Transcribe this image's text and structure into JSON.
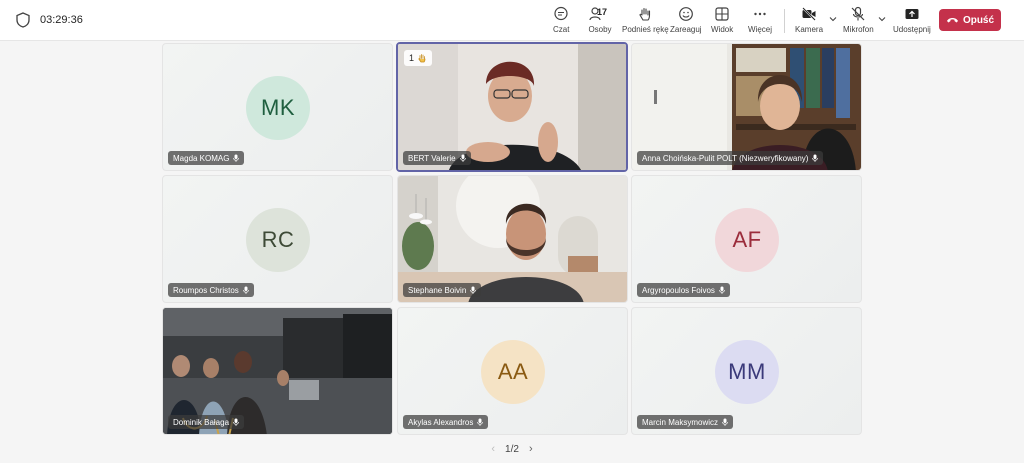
{
  "topbar": {
    "timer": "03:29:36",
    "buttons": {
      "chat": "Czat",
      "people": "Osoby",
      "people_count": "17",
      "raise": "Podnieś rękę",
      "react": "Zareaguj",
      "view": "Widok",
      "more": "Więcej",
      "camera": "Kamera",
      "mic": "Mikrofon",
      "share": "Udostępnij",
      "leave": "Opuść"
    }
  },
  "tiles": [
    {
      "name": "Magda KOMAG",
      "initials": "MK",
      "avatar_bg": "#cfe8dc",
      "avatar_fg": "#1f5f3f"
    },
    {
      "name": "BERT Valerie",
      "hand_count": "1"
    },
    {
      "name": "Anna Choińska-Pulit POLT (Niezweryfikowany)"
    },
    {
      "name": "Roumpos Christos",
      "initials": "RC",
      "avatar_bg": "#dde3da",
      "avatar_fg": "#3d4a36"
    },
    {
      "name": "Stephane Boivin"
    },
    {
      "name": "Argyropoulos Foivos",
      "initials": "AF",
      "avatar_bg": "#f1d7da",
      "avatar_fg": "#9b2c3b"
    },
    {
      "name": "Dominik Bałaga"
    },
    {
      "name": "Akylas Alexandros",
      "initials": "AA",
      "avatar_bg": "#f5e3c5",
      "avatar_fg": "#8a5a12"
    },
    {
      "name": "Marcin Maksymowicz",
      "initials": "MM",
      "avatar_bg": "#dcdcf2",
      "avatar_fg": "#3b3a7a"
    }
  ],
  "pager": {
    "label": "1/2"
  }
}
